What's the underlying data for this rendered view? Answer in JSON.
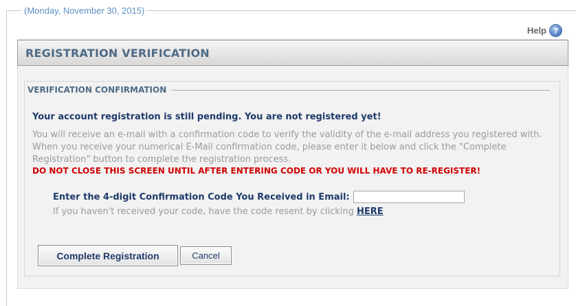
{
  "header": {
    "date_legend": "(Monday, November 30, 2015)",
    "help_label": "Help",
    "help_icon": "help-question-icon"
  },
  "panel": {
    "title": "REGISTRATION VERIFICATION"
  },
  "section": {
    "legend": "VERIFICATION CONFIRMATION",
    "pending_message": "Your account registration is still pending. You are not registered yet!",
    "info_text": "You will receive an e-mail with a confirmation code to verify the validity of the e-mail address you registered with. When you receive your numerical E-Mail confirmation code, please enter it below and click the \"Complete Registration\" button to complete the registration process.",
    "warning": "DO NOT CLOSE THIS SCREEN UNTIL AFTER ENTERING CODE OR YOU WILL HAVE TO RE-REGISTER!"
  },
  "form": {
    "code_label": "Enter the 4-digit Confirmation Code You Received in Email:",
    "code_value": "",
    "resend_text": "If you haven't received your code, have the code resent by clicking",
    "resend_link": "HERE",
    "complete_button": "Complete Registration",
    "cancel_button": "Cancel"
  },
  "colors": {
    "accent": "#1f3a6a",
    "warning": "#d00000",
    "legend": "#5a8fc2"
  }
}
